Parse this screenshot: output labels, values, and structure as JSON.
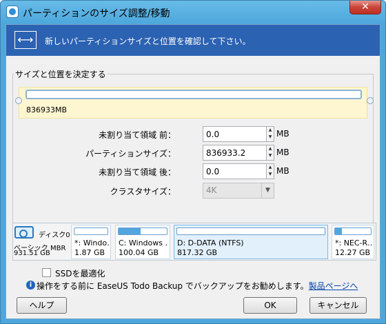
{
  "window": {
    "title": "パーティションのサイズ調整/移動",
    "close_label": "✕"
  },
  "banner": {
    "text": "新しいパーティションサイズと位置を確認して下さい。"
  },
  "group": {
    "legend": "サイズと位置を決定する"
  },
  "partition_bar": {
    "size_label": "836933MB"
  },
  "fields": {
    "before": {
      "label": "未割り当て領域 前：",
      "value": "0.0",
      "unit": "MB"
    },
    "size": {
      "label": "パーティションサイズ：",
      "value": "836933.2",
      "unit": "MB"
    },
    "after": {
      "label": "未割り当て領域 後：",
      "value": "0.0",
      "unit": "MB"
    },
    "cluster": {
      "label": "クラスタサイズ：",
      "value": "4K"
    }
  },
  "disk": {
    "name": "ディスク0",
    "type": "ベーシック MBR",
    "size": "931.51 GB",
    "partitions": [
      {
        "name": "*: Windo…",
        "size": "1.87 GB",
        "used": 0
      },
      {
        "name": "C: Windows …",
        "size": "100.04 GB",
        "used": 0.45
      },
      {
        "name": "D: D-DATA (NTFS)",
        "size": "817.32 GB",
        "used": 0
      },
      {
        "name": "*: NEC-R…",
        "size": "12.27 GB",
        "used": 0.2
      }
    ]
  },
  "ssd": {
    "label": "SSDを最適化",
    "checked": false
  },
  "info": {
    "text": "操作をする前に EaseUS Todo Backup でバックアップをお勧めします。",
    "link": "製品ページへ"
  },
  "buttons": {
    "help": "ヘルプ",
    "ok": "OK",
    "cancel": "キャンセル"
  }
}
